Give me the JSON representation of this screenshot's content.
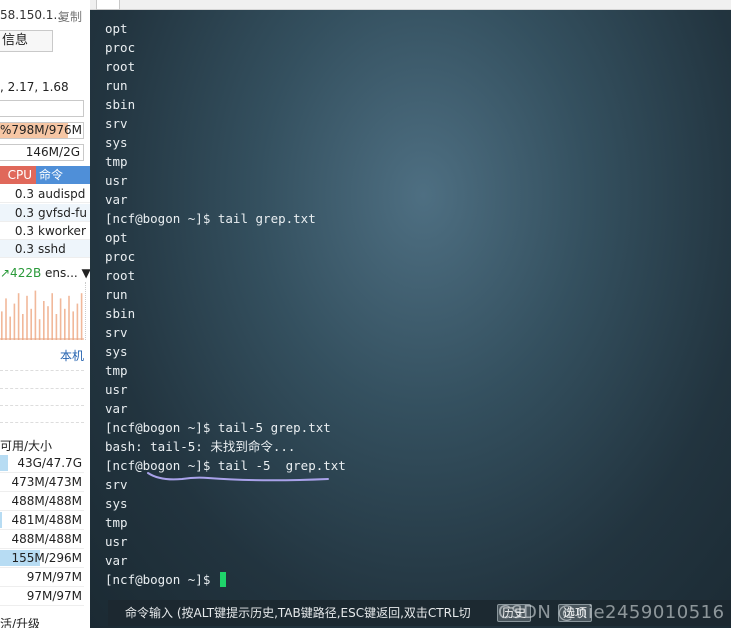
{
  "server": {
    "ip_fragment": "58.150.1...",
    "copy_label": "复制"
  },
  "info_tab": "信息",
  "load": ", 2.17, 1.68",
  "bars": {
    "cpu": {
      "label": "",
      "fill": 0
    },
    "memory": {
      "label": "%798M/976M",
      "fill": 0.82
    },
    "swap": {
      "label": "146M/2G",
      "fill": 0
    }
  },
  "process_table": {
    "headers": {
      "cpu": "CPU",
      "command": "命令"
    },
    "rows": [
      {
        "cpu": "0.3",
        "command": "audispd"
      },
      {
        "cpu": "0.3",
        "command": "gvfsd-fu"
      },
      {
        "cpu": "0.3",
        "command": "kworker"
      },
      {
        "cpu": "0.3",
        "command": "sshd"
      }
    ]
  },
  "network": {
    "up": "↗422B",
    "interface": "ens...",
    "dropdown": "▼"
  },
  "network_chart": {
    "type": "bar",
    "values": [
      0.55,
      0.8,
      0.45,
      0.7,
      0.9,
      0.5,
      0.85,
      0.6,
      0.95,
      0.4,
      0.75,
      0.65,
      0.9,
      0.5,
      0.8,
      0.6,
      0.85,
      0.55,
      0.7,
      0.9
    ],
    "colors": {
      "bars": "#f1b89a",
      "line": "#e8a27d"
    }
  },
  "local_tab": "本机",
  "disk": {
    "header": "可用/大小",
    "rows": [
      {
        "label": "43G/47.7G",
        "fill": 0.1
      },
      {
        "label": "473M/473M",
        "fill": 0
      },
      {
        "label": "488M/488M",
        "fill": 0
      },
      {
        "label": "481M/488M",
        "fill": 0.02
      },
      {
        "label": "488M/488M",
        "fill": 0
      },
      {
        "label": "155M/296M",
        "fill": 0.48
      },
      {
        "label": "97M/97M",
        "fill": 0
      },
      {
        "label": "97M/97M",
        "fill": 0
      }
    ]
  },
  "bottom_cut": "活/升级",
  "terminal": {
    "lines": [
      "opt",
      "proc",
      "root",
      "run",
      "sbin",
      "srv",
      "sys",
      "tmp",
      "usr",
      "var",
      "[ncf@bogon ~]$ tail grep.txt",
      "opt",
      "proc",
      "root",
      "run",
      "sbin",
      "srv",
      "sys",
      "tmp",
      "usr",
      "var",
      "[ncf@bogon ~]$ tail-5 grep.txt",
      "bash: tail-5: 未找到命令...",
      "[ncf@bogon ~]$ tail -5  grep.txt",
      "srv",
      "sys",
      "tmp",
      "usr",
      "var"
    ],
    "prompt": "[ncf@bogon ~]$ ",
    "cursor_color": "#1fd36a",
    "annotation_color": "#a9a2ea"
  },
  "statusbar": {
    "hint": "命令输入 (按ALT键提示历史,TAB键路径,ESC键返回,双击CTRL切",
    "history_label": "历史",
    "options_label": "选项",
    "watermark": "CSDN @nie2459010516"
  }
}
